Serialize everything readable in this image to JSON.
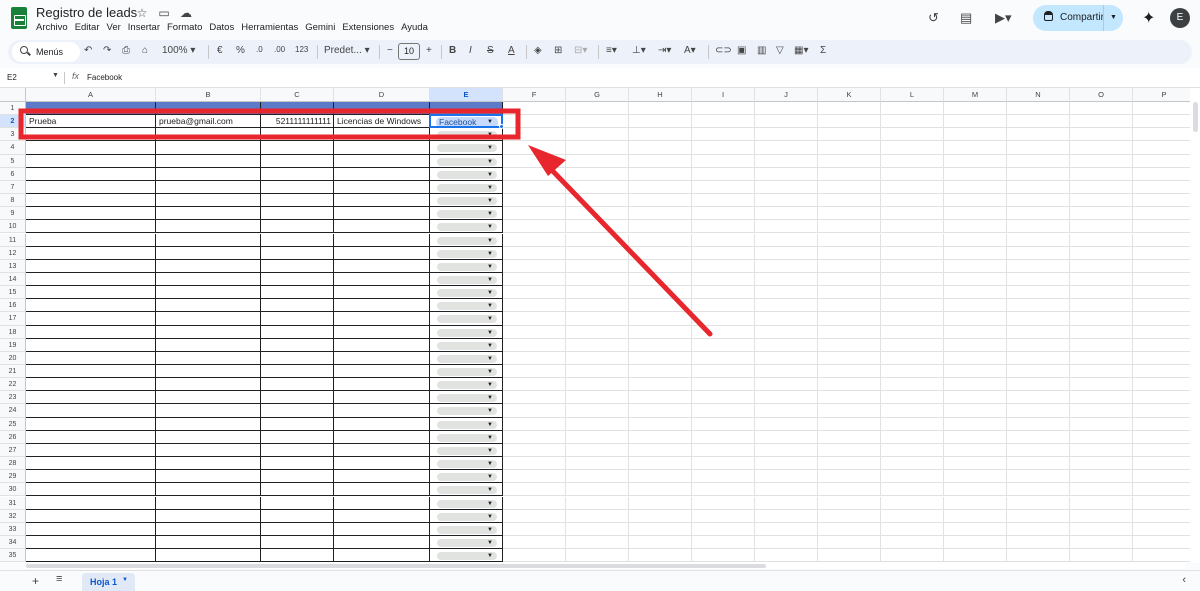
{
  "app": {
    "doc_title": "Registro de leads",
    "menu": [
      "Archivo",
      "Editar",
      "Ver",
      "Insertar",
      "Formato",
      "Datos",
      "Herramientas",
      "Gemini",
      "Extensiones",
      "Ayuda"
    ],
    "share_label": "Compartir",
    "avatar_initial": "E"
  },
  "toolbar": {
    "search_label": "Menús",
    "zoom": "100%",
    "currency": "€",
    "percent": "%",
    "dec_decrease": ".0",
    "dec_increase": ".00",
    "number_format": "123",
    "font_name": "Predet...",
    "font_size": "10"
  },
  "formula_bar": {
    "cell_ref": "E2",
    "fx": "fx",
    "value": "Facebook"
  },
  "grid": {
    "columns": [
      "A",
      "B",
      "C",
      "D",
      "E",
      "F",
      "G",
      "H",
      "I",
      "J",
      "K",
      "L",
      "M",
      "N",
      "O",
      "P"
    ],
    "selected_column": "E",
    "row_count": 35,
    "selected_row": 2,
    "row2": {
      "A": "Prueba",
      "B": "prueba@gmail.com",
      "C": "5211111111111",
      "D": "Licencias de Windows",
      "E": "Facebook"
    }
  },
  "sheets": {
    "active": "Hoja 1"
  },
  "colors": {
    "header_fill": "#5b7bc8",
    "annotation_red": "#e8262d",
    "selection_blue": "#1a73e8",
    "share_bg": "#c2e7ff"
  },
  "icons": [
    "history-icon",
    "comment-icon",
    "video-icon",
    "lock-icon",
    "gemini-icon",
    "search-icon",
    "undo-icon",
    "redo-icon",
    "print-icon",
    "paint-format-icon",
    "bold-icon",
    "italic-icon",
    "strikethrough-icon",
    "text-color-icon",
    "fill-color-icon",
    "borders-icon",
    "merge-icon",
    "align-icon",
    "valign-icon",
    "wrap-icon",
    "rotate-icon",
    "link-icon",
    "insert-comment-icon",
    "chart-icon",
    "filter-icon",
    "filter-views-icon",
    "functions-icon",
    "add-sheet-icon",
    "all-sheets-icon"
  ]
}
